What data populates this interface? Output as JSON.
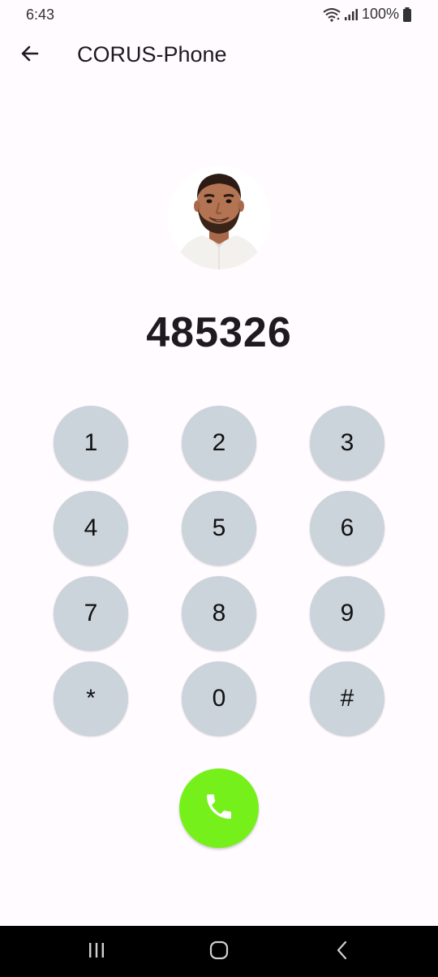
{
  "status_bar": {
    "time": "6:43",
    "battery": "100%"
  },
  "app_bar": {
    "title": "CORUS-Phone",
    "back_icon": "arrow-left-icon"
  },
  "contact": {
    "avatar_icon": "person-photo",
    "number": "485326"
  },
  "keypad": {
    "keys": [
      "1",
      "2",
      "3",
      "4",
      "5",
      "6",
      "7",
      "8",
      "9",
      "*",
      "0",
      "#"
    ]
  },
  "call": {
    "icon": "phone-icon",
    "color": "#76f01b"
  },
  "nav_bar": {
    "recents_icon": "recents-icon",
    "home_icon": "home-icon",
    "back_icon": "nav-back-icon"
  },
  "colors": {
    "background": "#fffbfe",
    "key_background": "#cbd3db",
    "nav_background": "#000000"
  }
}
